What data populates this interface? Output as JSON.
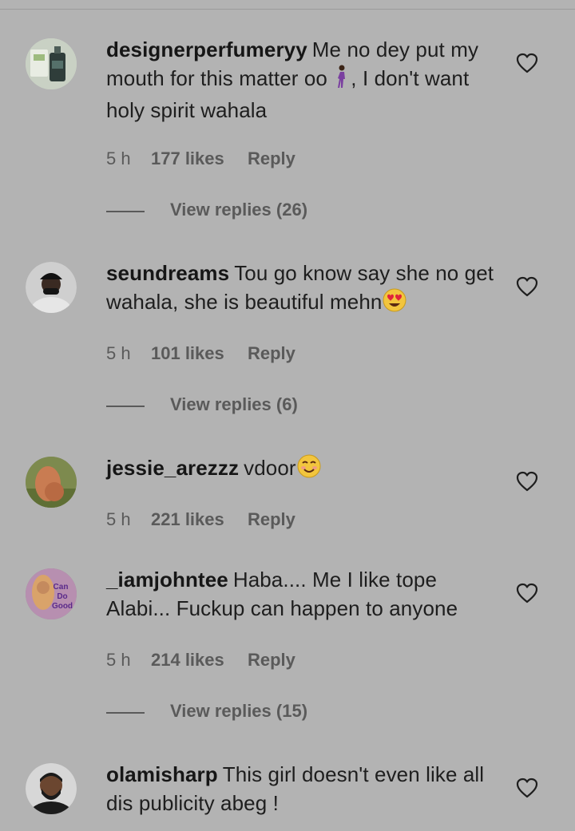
{
  "comments": [
    {
      "username": "designerperfumeryy",
      "text_before_emoji": "Me no dey put my mouth for this matter oo ",
      "emoji": "person-walking-emoji",
      "text_after_emoji": ", I don't want holy spirit wahala",
      "time": "5 h",
      "likes": "177 likes",
      "reply": "Reply",
      "view_replies": "View replies (26)",
      "avatar": "perfume-bottle-avatar"
    },
    {
      "username": "seundreams",
      "text_before_emoji": "Tou go know say she no get wahala, she is beautiful mehn",
      "emoji": "heart-eyes-emoji",
      "text_after_emoji": "",
      "time": "5 h",
      "likes": "101 likes",
      "reply": "Reply",
      "view_replies": "View replies (6)",
      "avatar": "man-in-cap-avatar"
    },
    {
      "username": "jessie_arezzz",
      "text_before_emoji": "vdoor",
      "emoji": "smiling-face-emoji",
      "text_after_emoji": "",
      "time": "5 h",
      "likes": "221 likes",
      "reply": "Reply",
      "view_replies": "",
      "avatar": "photo-avatar"
    },
    {
      "username": "_iamjohntee",
      "text_before_emoji": "Haba.... Me I like tope Alabi... Fuckup can happen to anyone",
      "emoji": "",
      "text_after_emoji": "",
      "time": "5 h",
      "likes": "214 likes",
      "reply": "Reply",
      "view_replies": "View replies (15)",
      "avatar": "can-do-good-avatar"
    },
    {
      "username": "olamisharp",
      "text_before_emoji": "This girl doesn't even like all dis publicity abeg !",
      "emoji": "",
      "text_after_emoji": "",
      "time": "",
      "likes": "",
      "reply": "",
      "view_replies": "",
      "avatar": "bearded-man-avatar"
    }
  ],
  "avatar_badge_text": [
    "Can",
    "Do",
    "Good"
  ],
  "colors": {
    "background": "#b3b3b3",
    "text": "#1e1e1e",
    "meta": "#5a5a5a"
  }
}
